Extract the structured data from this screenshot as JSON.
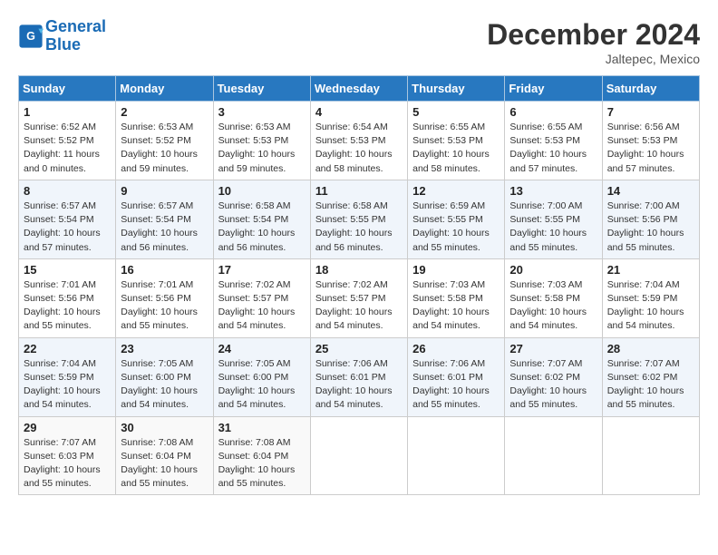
{
  "header": {
    "logo_line1": "General",
    "logo_line2": "Blue",
    "month": "December 2024",
    "location": "Jaltepec, Mexico"
  },
  "days_of_week": [
    "Sunday",
    "Monday",
    "Tuesday",
    "Wednesday",
    "Thursday",
    "Friday",
    "Saturday"
  ],
  "weeks": [
    [
      {
        "day": "1",
        "detail": "Sunrise: 6:52 AM\nSunset: 5:52 PM\nDaylight: 11 hours\nand 0 minutes."
      },
      {
        "day": "2",
        "detail": "Sunrise: 6:53 AM\nSunset: 5:52 PM\nDaylight: 10 hours\nand 59 minutes."
      },
      {
        "day": "3",
        "detail": "Sunrise: 6:53 AM\nSunset: 5:53 PM\nDaylight: 10 hours\nand 59 minutes."
      },
      {
        "day": "4",
        "detail": "Sunrise: 6:54 AM\nSunset: 5:53 PM\nDaylight: 10 hours\nand 58 minutes."
      },
      {
        "day": "5",
        "detail": "Sunrise: 6:55 AM\nSunset: 5:53 PM\nDaylight: 10 hours\nand 58 minutes."
      },
      {
        "day": "6",
        "detail": "Sunrise: 6:55 AM\nSunset: 5:53 PM\nDaylight: 10 hours\nand 57 minutes."
      },
      {
        "day": "7",
        "detail": "Sunrise: 6:56 AM\nSunset: 5:53 PM\nDaylight: 10 hours\nand 57 minutes."
      }
    ],
    [
      {
        "day": "8",
        "detail": "Sunrise: 6:57 AM\nSunset: 5:54 PM\nDaylight: 10 hours\nand 57 minutes."
      },
      {
        "day": "9",
        "detail": "Sunrise: 6:57 AM\nSunset: 5:54 PM\nDaylight: 10 hours\nand 56 minutes."
      },
      {
        "day": "10",
        "detail": "Sunrise: 6:58 AM\nSunset: 5:54 PM\nDaylight: 10 hours\nand 56 minutes."
      },
      {
        "day": "11",
        "detail": "Sunrise: 6:58 AM\nSunset: 5:55 PM\nDaylight: 10 hours\nand 56 minutes."
      },
      {
        "day": "12",
        "detail": "Sunrise: 6:59 AM\nSunset: 5:55 PM\nDaylight: 10 hours\nand 55 minutes."
      },
      {
        "day": "13",
        "detail": "Sunrise: 7:00 AM\nSunset: 5:55 PM\nDaylight: 10 hours\nand 55 minutes."
      },
      {
        "day": "14",
        "detail": "Sunrise: 7:00 AM\nSunset: 5:56 PM\nDaylight: 10 hours\nand 55 minutes."
      }
    ],
    [
      {
        "day": "15",
        "detail": "Sunrise: 7:01 AM\nSunset: 5:56 PM\nDaylight: 10 hours\nand 55 minutes."
      },
      {
        "day": "16",
        "detail": "Sunrise: 7:01 AM\nSunset: 5:56 PM\nDaylight: 10 hours\nand 55 minutes."
      },
      {
        "day": "17",
        "detail": "Sunrise: 7:02 AM\nSunset: 5:57 PM\nDaylight: 10 hours\nand 54 minutes."
      },
      {
        "day": "18",
        "detail": "Sunrise: 7:02 AM\nSunset: 5:57 PM\nDaylight: 10 hours\nand 54 minutes."
      },
      {
        "day": "19",
        "detail": "Sunrise: 7:03 AM\nSunset: 5:58 PM\nDaylight: 10 hours\nand 54 minutes."
      },
      {
        "day": "20",
        "detail": "Sunrise: 7:03 AM\nSunset: 5:58 PM\nDaylight: 10 hours\nand 54 minutes."
      },
      {
        "day": "21",
        "detail": "Sunrise: 7:04 AM\nSunset: 5:59 PM\nDaylight: 10 hours\nand 54 minutes."
      }
    ],
    [
      {
        "day": "22",
        "detail": "Sunrise: 7:04 AM\nSunset: 5:59 PM\nDaylight: 10 hours\nand 54 minutes."
      },
      {
        "day": "23",
        "detail": "Sunrise: 7:05 AM\nSunset: 6:00 PM\nDaylight: 10 hours\nand 54 minutes."
      },
      {
        "day": "24",
        "detail": "Sunrise: 7:05 AM\nSunset: 6:00 PM\nDaylight: 10 hours\nand 54 minutes."
      },
      {
        "day": "25",
        "detail": "Sunrise: 7:06 AM\nSunset: 6:01 PM\nDaylight: 10 hours\nand 54 minutes."
      },
      {
        "day": "26",
        "detail": "Sunrise: 7:06 AM\nSunset: 6:01 PM\nDaylight: 10 hours\nand 55 minutes."
      },
      {
        "day": "27",
        "detail": "Sunrise: 7:07 AM\nSunset: 6:02 PM\nDaylight: 10 hours\nand 55 minutes."
      },
      {
        "day": "28",
        "detail": "Sunrise: 7:07 AM\nSunset: 6:02 PM\nDaylight: 10 hours\nand 55 minutes."
      }
    ],
    [
      {
        "day": "29",
        "detail": "Sunrise: 7:07 AM\nSunset: 6:03 PM\nDaylight: 10 hours\nand 55 minutes."
      },
      {
        "day": "30",
        "detail": "Sunrise: 7:08 AM\nSunset: 6:04 PM\nDaylight: 10 hours\nand 55 minutes."
      },
      {
        "day": "31",
        "detail": "Sunrise: 7:08 AM\nSunset: 6:04 PM\nDaylight: 10 hours\nand 55 minutes."
      },
      {
        "day": "",
        "detail": ""
      },
      {
        "day": "",
        "detail": ""
      },
      {
        "day": "",
        "detail": ""
      },
      {
        "day": "",
        "detail": ""
      }
    ]
  ]
}
